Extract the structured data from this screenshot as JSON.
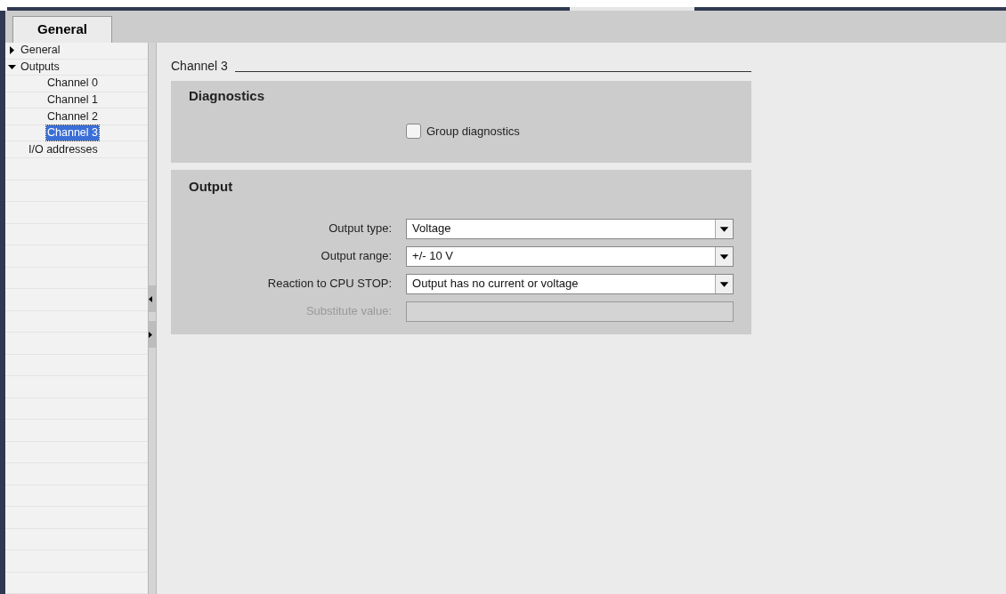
{
  "tabs": [
    {
      "label": "General",
      "selected": true
    }
  ],
  "tree": [
    {
      "label": "General",
      "expanded": false,
      "selected": false
    },
    {
      "label": "Outputs",
      "expanded": true,
      "selected": false,
      "children": [
        {
          "label": "Channel 0",
          "selected": false
        },
        {
          "label": "Channel 1",
          "selected": false
        },
        {
          "label": "Channel 2",
          "selected": false
        },
        {
          "label": "Channel 3",
          "selected": true
        }
      ]
    },
    {
      "label": "I/O addresses",
      "selected": false
    }
  ],
  "section_title": "Channel 3",
  "diagnostics": {
    "title": "Diagnostics",
    "checkbox": {
      "label": "Group diagnostics",
      "checked": false
    }
  },
  "output": {
    "title": "Output",
    "fields": [
      {
        "kind": "select",
        "label": "Output type:",
        "value": "Voltage",
        "disabled": false
      },
      {
        "kind": "select",
        "label": "Output range:",
        "value": "+/- 10 V",
        "disabled": false
      },
      {
        "kind": "select",
        "label": "Reaction to CPU STOP:",
        "value": "Output has no current or voltage",
        "disabled": false
      },
      {
        "kind": "text",
        "label": "Substitute value:",
        "disabled": true
      }
    ]
  }
}
